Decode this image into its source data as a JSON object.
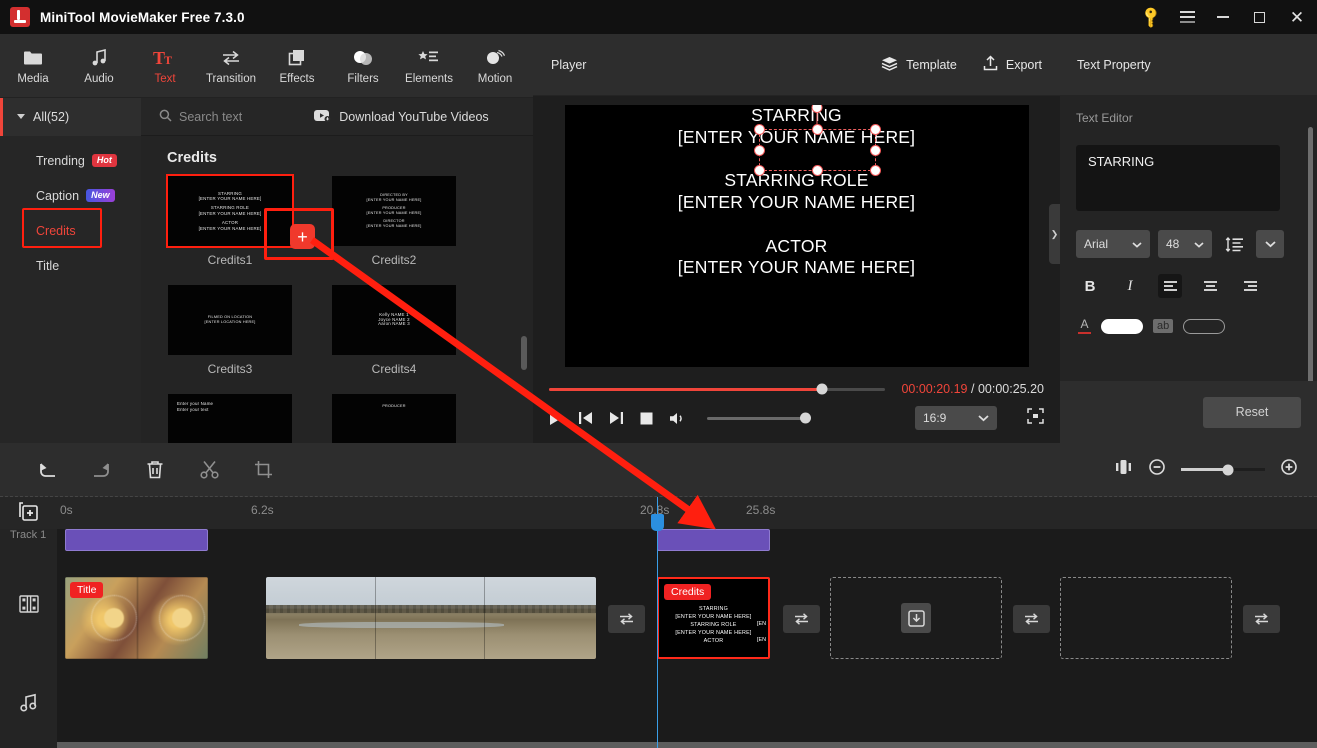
{
  "window": {
    "title": "MiniTool MovieMaker Free 7.3.0",
    "controls": {
      "key": "key-icon",
      "menu": "menu-icon",
      "minimize": "minimize-icon",
      "maximize": "maximize-icon",
      "close": "close-icon"
    }
  },
  "toolbar": {
    "items": [
      {
        "label": "Media",
        "icon": "folder-icon",
        "active": false
      },
      {
        "label": "Audio",
        "icon": "music-note-icon",
        "active": false
      },
      {
        "label": "Text",
        "icon": "text-tt-icon",
        "active": true
      },
      {
        "label": "Transition",
        "icon": "transition-arrows-icon",
        "active": false
      },
      {
        "label": "Effects",
        "icon": "effects-squares-icon",
        "active": false
      },
      {
        "label": "Filters",
        "icon": "filters-circles-icon",
        "active": false
      },
      {
        "label": "Elements",
        "icon": "elements-star-list-icon",
        "active": false
      },
      {
        "label": "Motion",
        "icon": "motion-ball-icon",
        "active": false
      }
    ]
  },
  "library": {
    "all_label": "All(52)",
    "search_placeholder": "Search text",
    "download_label": "Download YouTube Videos",
    "categories": [
      {
        "label": "Trending",
        "badge": "Hot",
        "badge_kind": "hot",
        "selected": false
      },
      {
        "label": "Caption",
        "badge": "New",
        "badge_kind": "new",
        "selected": false
      },
      {
        "label": "Credits",
        "badge": "",
        "badge_kind": "",
        "selected": true
      },
      {
        "label": "Title",
        "badge": "",
        "badge_kind": "",
        "selected": false
      }
    ],
    "grid_title": "Credits",
    "templates": [
      {
        "label": "Credits1",
        "selected": true,
        "preview": [
          "STARRING",
          "[ENTER YOUR NAME HERE]",
          "STARRING ROLE",
          "[ENTER YOUR NAME HERE]",
          "ACTOR",
          "[ENTER YOUR NAME HERE]"
        ]
      },
      {
        "label": "Credits2",
        "selected": false,
        "preview": [
          "DIRECTED BY",
          "[ENTER YOUR NAME HERE]",
          "PRODUCER",
          "[ENTER YOUR NAME HERE]",
          "DIRECTOR",
          "[ENTER YOUR NAME HERE]"
        ]
      },
      {
        "label": "Credits3",
        "selected": false,
        "preview": [
          "FILMED ON LOCATION",
          "[ENTER LOCATION HERE]"
        ]
      },
      {
        "label": "Credits4",
        "selected": false,
        "preview": [
          "Kelly NAME 1",
          "Joyce NAME 2",
          "Aaron NAME 3"
        ]
      },
      {
        "label": "",
        "selected": false,
        "preview": [
          "Enter your Name",
          "Enter your text"
        ]
      },
      {
        "label": "",
        "selected": false,
        "preview": [
          "PRODUCER"
        ]
      }
    ]
  },
  "player": {
    "label": "Player",
    "template_label": "Template",
    "export_label": "Export",
    "stage_text": {
      "group1": [
        "STARRING",
        "[ENTER YOUR NAME HERE]"
      ],
      "group2": [
        "STARRING ROLE",
        "[ENTER YOUR NAME HERE]"
      ],
      "group3": [
        "ACTOR",
        "[ENTER YOUR NAME HERE]"
      ]
    },
    "current_time": "00:00:20.19",
    "separator": "/",
    "total_time": "00:00:25.20",
    "progress_percent": 81,
    "aspect_ratio": "16:9",
    "controls": [
      "play-icon",
      "previous-frame-icon",
      "next-frame-icon",
      "stop-icon",
      "volume-icon",
      "fullscreen-icon"
    ]
  },
  "text_property": {
    "title": "Text Property",
    "section_label": "Text Editor",
    "editor_value": "STARRING",
    "font_family": "Arial",
    "font_size": "48",
    "bold_label": "B",
    "italic_label": "I",
    "align_active": "left",
    "ab_label": "ab",
    "text_color": "#ffffff",
    "reset_label": "Reset"
  },
  "timeline": {
    "tools": [
      "undo-icon",
      "redo-icon",
      "delete-icon",
      "split-scissors-icon",
      "crop-icon"
    ],
    "right_tools": [
      "split-view-icon",
      "zoom-out-icon",
      "zoom-in-icon"
    ],
    "zoom_percent": 56,
    "ruler_ticks": [
      "0s",
      "6.2s",
      "20.8s",
      "25.8s"
    ],
    "add_track_icon": "add-media-icon",
    "gutter": {
      "text_track": "Track 1",
      "video_track": "film-icon",
      "audio_track": "music-icon"
    },
    "clips": [
      {
        "type": "title",
        "badge": "Title",
        "art": "warm"
      },
      {
        "type": "video",
        "badge": "",
        "art": "landscape"
      },
      {
        "type": "credits",
        "badge": "Credits",
        "art": "credits",
        "lines": [
          "STARRING",
          "[ENTER YOUR NAME HERE]",
          "STARRING ROLE",
          "[ENTER YOUR NAME HERE]",
          "ACTOR"
        ],
        "right_lines": [
          "[EN",
          "[EN"
        ]
      }
    ],
    "transition_icon": "transition-arrows-icon",
    "drop_slot_icon": "import-down-icon"
  },
  "colors": {
    "accent_red": "#f0453a",
    "highlight_red": "#ff1f0f",
    "playhead_blue": "#3a9fe8",
    "text_track_purple": "#6a50b8",
    "panel_bg": "#242424",
    "header_bg": "#2d2d2d"
  }
}
